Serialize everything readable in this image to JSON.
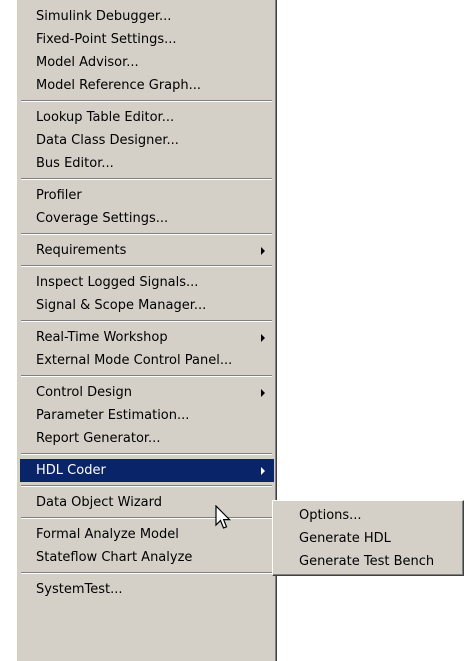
{
  "menu": {
    "groups": [
      {
        "items": [
          {
            "label": "Simulink Debugger..."
          },
          {
            "label": "Fixed-Point Settings..."
          },
          {
            "label": "Model Advisor..."
          },
          {
            "label": "Model Reference Graph..."
          }
        ]
      },
      {
        "items": [
          {
            "label": "Lookup Table Editor..."
          },
          {
            "label": "Data Class Designer..."
          },
          {
            "label": "Bus Editor..."
          }
        ]
      },
      {
        "items": [
          {
            "label": "Profiler"
          },
          {
            "label": "Coverage Settings..."
          }
        ]
      },
      {
        "items": [
          {
            "label": "Requirements",
            "submenu": true
          }
        ]
      },
      {
        "items": [
          {
            "label": "Inspect Logged Signals..."
          },
          {
            "label": "Signal & Scope Manager..."
          }
        ]
      },
      {
        "items": [
          {
            "label": "Real-Time Workshop",
            "submenu": true
          },
          {
            "label": "External Mode Control Panel..."
          }
        ]
      },
      {
        "items": [
          {
            "label": "Control Design",
            "submenu": true
          },
          {
            "label": "Parameter Estimation..."
          },
          {
            "label": "Report Generator..."
          }
        ]
      },
      {
        "items": [
          {
            "label": "HDL Coder",
            "submenu": true,
            "selected": true
          }
        ]
      },
      {
        "items": [
          {
            "label": "Data Object Wizard"
          }
        ]
      },
      {
        "items": [
          {
            "label": "Formal Analyze Model"
          },
          {
            "label": "Stateflow Chart Analyze"
          }
        ]
      },
      {
        "items": [
          {
            "label": "SystemTest..."
          }
        ]
      }
    ]
  },
  "submenu": {
    "items": [
      {
        "label": "Options..."
      },
      {
        "label": "Generate HDL"
      },
      {
        "label": "Generate Test Bench"
      }
    ]
  },
  "colors": {
    "menu_background": "#d4d0c8",
    "selection_background": "#0a246a",
    "selection_text": "#ffffff"
  },
  "icons": {
    "submenu_arrow": "submenu-arrow-icon",
    "cursor": "mouse-pointer-icon"
  }
}
